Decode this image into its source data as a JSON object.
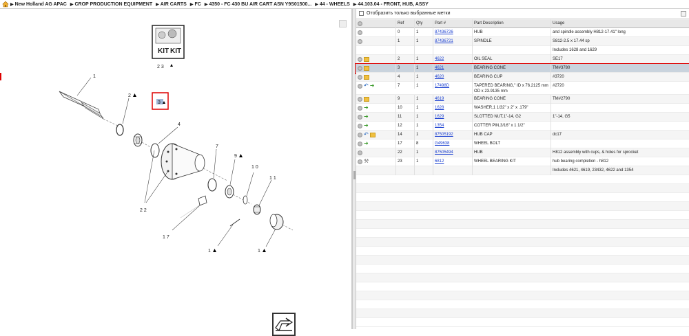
{
  "breadcrumb": [
    "New Holland AG APAC",
    "CROP PRODUCTION EQUIPMENT",
    "AIR CARTS",
    "FC",
    "4350 - FC 430 BU AIR CART ASN Y9S01500...",
    "44 - WHEELS",
    "44.103.04 - FRONT, HUB, ASSY"
  ],
  "filter": {
    "label": "Отобразить только выбранные метки"
  },
  "table": {
    "headers": {
      "ref": "Ref",
      "qty": "Qty",
      "part": "Part #",
      "desc": "Part Description",
      "usage": "Usage"
    },
    "rows": [
      {
        "icons": [
          "gear"
        ],
        "ref": "0",
        "qty": "1",
        "part": "87436726",
        "desc": "HUB",
        "usage": "and spindle assembly H812-17.41\" long"
      },
      {
        "icons": [
          "gear"
        ],
        "ref": "1",
        "qty": "1",
        "part": "87436721",
        "desc": "SPINDLE",
        "usage": "S812-2.5 x 17.44 sp"
      },
      {
        "icons": [],
        "ref": "",
        "qty": "",
        "part": "",
        "desc": "",
        "usage": "Includes 1628 and 1629"
      },
      {
        "icons": [
          "gear",
          "kit"
        ],
        "ref": "2",
        "qty": "1",
        "part": "4622",
        "desc": "OIL SEAL",
        "usage": "SE17"
      },
      {
        "icons": [
          "gear",
          "kit"
        ],
        "ref": "3",
        "qty": "1",
        "part": "4621",
        "desc": "BEARING CONE",
        "usage": "TM#3780",
        "selected": true
      },
      {
        "icons": [
          "gear",
          "kit"
        ],
        "ref": "4",
        "qty": "1",
        "part": "4620",
        "desc": "BEARING CUP",
        "usage": "#3720"
      },
      {
        "icons": [
          "gear",
          "back",
          "arrow"
        ],
        "ref": "7",
        "qty": "1",
        "part": "17498D",
        "desc": "TAPERED BEARING,\" ID x 76.2125 mm OD x 23.9135 mm",
        "usage": "#2720",
        "tall": true
      },
      {
        "icons": [
          "gear",
          "kit"
        ],
        "ref": "9",
        "qty": "1",
        "part": "4619",
        "desc": "BEARING CONE",
        "usage": "TM#2790"
      },
      {
        "icons": [
          "gear",
          "arrow"
        ],
        "ref": "10",
        "qty": "1",
        "part": "1628",
        "desc": "WASHER,1 1/32\" x 2\" x .179\"",
        "usage": ""
      },
      {
        "icons": [
          "gear",
          "arrow"
        ],
        "ref": "11",
        "qty": "1",
        "part": "1629",
        "desc": "SLOTTED NUT,1\"-14, G2",
        "usage": "1\"-14, G5"
      },
      {
        "icons": [
          "gear",
          "arrow"
        ],
        "ref": "12",
        "qty": "1",
        "part": "1354",
        "desc": "COTTER PIN,3/16\" x 1 1/2\"",
        "usage": ""
      },
      {
        "icons": [
          "gear",
          "back",
          "kit"
        ],
        "ref": "14",
        "qty": "1",
        "part": "87505192",
        "desc": "HUB CAP",
        "usage": "dc17"
      },
      {
        "icons": [
          "gear",
          "arrow"
        ],
        "ref": "17",
        "qty": "8",
        "part": "G49638",
        "desc": "WHEEL BOLT",
        "usage": ""
      },
      {
        "icons": [
          "gear"
        ],
        "ref": "22",
        "qty": "1",
        "part": "87505494",
        "desc": "HUB",
        "usage": "H812 assembly with cups, & holes for sprocket"
      },
      {
        "icons": [
          "gear",
          "wrench"
        ],
        "ref": "23",
        "qty": "1",
        "part": "6812",
        "desc": "WHEEL BEARING KIT",
        "usage": "hub bearing completion - h812"
      },
      {
        "icons": [],
        "ref": "",
        "qty": "",
        "part": "",
        "desc": "",
        "usage": "Includes 4621, 4619, 23432, 4622 and 1354"
      }
    ]
  },
  "diagram": {
    "kit_text": "KIT",
    "kit_label": "2 3",
    "callouts": [
      "1",
      "2",
      "3",
      "4",
      "7",
      "9",
      "1 0",
      "1 1",
      "1 7",
      "2 2",
      "1",
      "1"
    ],
    "selected_callout": "3"
  },
  "colors": {
    "link": "#1a3fd0",
    "highlight_border": "#dd0000",
    "selected_row": "#c9d3dd"
  }
}
